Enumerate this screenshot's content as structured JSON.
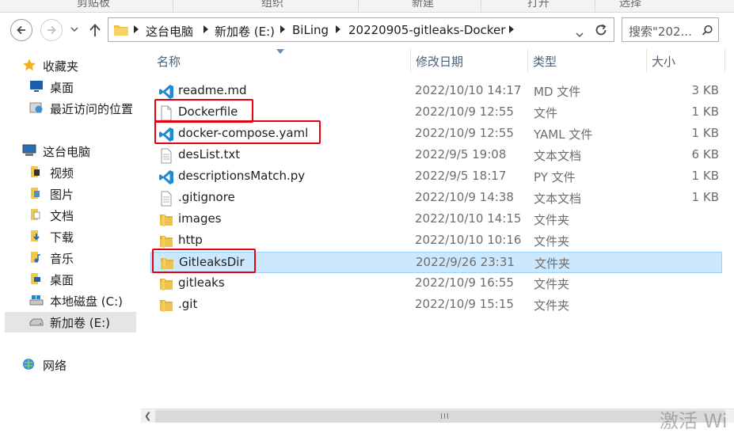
{
  "ribbon": {
    "groups": [
      "剪贴板",
      "组织",
      "新建",
      "打开",
      "选择"
    ]
  },
  "nav": {
    "back_icon": "back-arrow-icon",
    "forward_icon": "forward-arrow-icon",
    "up_icon": "up-arrow-icon",
    "dropdown_icon": "chevron-down-icon"
  },
  "address": {
    "breadcrumbs": [
      "这台电脑",
      "新加卷 (E:)",
      "BiLing",
      "20220905-gitleaks-Docker"
    ],
    "search_placeholder": "搜索\"202..."
  },
  "sidebar": {
    "items": [
      {
        "label": "收藏夹",
        "icon": "star-icon"
      },
      {
        "label": "桌面",
        "icon": "desktop-icon"
      },
      {
        "label": "最近访问的位置",
        "icon": "recent-places-icon"
      },
      {
        "label": "这台电脑",
        "icon": "computer-icon"
      },
      {
        "label": "视频",
        "icon": "videos-folder-icon"
      },
      {
        "label": "图片",
        "icon": "pictures-folder-icon"
      },
      {
        "label": "文档",
        "icon": "documents-folder-icon"
      },
      {
        "label": "下载",
        "icon": "downloads-folder-icon"
      },
      {
        "label": "音乐",
        "icon": "music-folder-icon"
      },
      {
        "label": "桌面",
        "icon": "desktop-folder-icon"
      },
      {
        "label": "本地磁盘 (C:)",
        "icon": "system-drive-icon"
      },
      {
        "label": "新加卷 (E:)",
        "icon": "drive-icon"
      },
      {
        "label": "网络",
        "icon": "network-icon"
      }
    ]
  },
  "columns": {
    "name": "名称",
    "date": "修改日期",
    "type": "类型",
    "size": "大小"
  },
  "files": [
    {
      "name": "readme.md",
      "date": "2022/10/10 14:17",
      "type": "MD 文件",
      "size": "3 KB",
      "icon": "vscode-file-icon"
    },
    {
      "name": "Dockerfile",
      "date": "2022/10/9 12:55",
      "type": "文件",
      "size": "1 KB",
      "icon": "blank-file-icon"
    },
    {
      "name": "docker-compose.yaml",
      "date": "2022/10/9 12:55",
      "type": "YAML 文件",
      "size": "1 KB",
      "icon": "vscode-file-icon"
    },
    {
      "name": "desList.txt",
      "date": "2022/9/5 19:08",
      "type": "文本文档",
      "size": "6 KB",
      "icon": "text-file-icon"
    },
    {
      "name": "descriptionsMatch.py",
      "date": "2022/9/5 18:17",
      "type": "PY 文件",
      "size": "1 KB",
      "icon": "vscode-file-icon"
    },
    {
      "name": ".gitignore",
      "date": "2022/10/9 14:38",
      "type": "文本文档",
      "size": "1 KB",
      "icon": "text-file-icon"
    },
    {
      "name": "images",
      "date": "2022/10/10 14:15",
      "type": "文件夹",
      "size": "",
      "icon": "folder-icon"
    },
    {
      "name": "http",
      "date": "2022/10/10 10:16",
      "type": "文件夹",
      "size": "",
      "icon": "folder-icon"
    },
    {
      "name": "GitleaksDir",
      "date": "2022/9/26 23:31",
      "type": "文件夹",
      "size": "",
      "icon": "folder-icon",
      "selected": true
    },
    {
      "name": "gitleaks",
      "date": "2022/10/9 16:55",
      "type": "文件夹",
      "size": "",
      "icon": "folder-icon"
    },
    {
      "name": ".git",
      "date": "2022/10/9 15:15",
      "type": "文件夹",
      "size": "",
      "icon": "folder-icon"
    }
  ],
  "scrollbar": {
    "grip": "III"
  },
  "watermark": "激活 Wi",
  "colors": {
    "selection_bg": "#cce8ff",
    "selection_border": "#99d1ff",
    "highlight_box": "#e60012",
    "header_text": "#4c607a",
    "vscode_blue": "#1f8ad2"
  }
}
